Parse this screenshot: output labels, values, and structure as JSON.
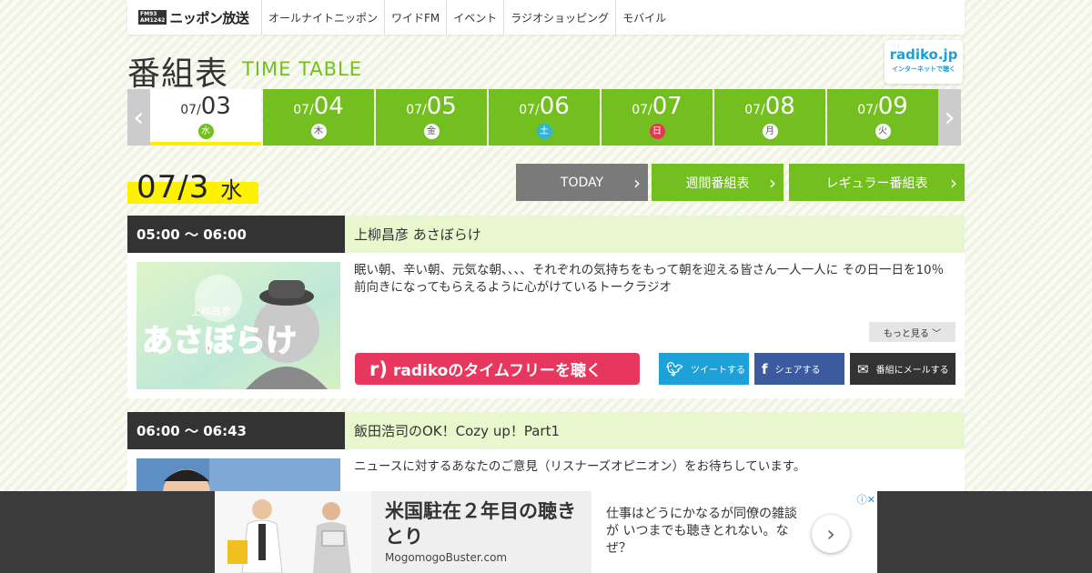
{
  "nav": {
    "logo_freq_top": "FM93",
    "logo_freq_bottom": "AM1242",
    "logo_name": "ニッポン放送",
    "items": [
      "オールナイトニッポン",
      "ワイドFM",
      "イベント",
      "ラジオショッピング",
      "モバイル"
    ]
  },
  "header": {
    "title_jp": "番組表",
    "title_en": "TIME TABLE",
    "radiko_logo": "radiko.jp",
    "radiko_sub": "インターネットで聴く"
  },
  "date_tabs": {
    "prev_icon": "chevron-left-icon",
    "next_icon": "chevron-right-icon",
    "items": [
      {
        "month": "07/",
        "day": "03",
        "weekday": "水"
      },
      {
        "month": "07/",
        "day": "04",
        "weekday": "木"
      },
      {
        "month": "07/",
        "day": "05",
        "weekday": "金"
      },
      {
        "month": "07/",
        "day": "06",
        "weekday": "土"
      },
      {
        "month": "07/",
        "day": "07",
        "weekday": "日"
      },
      {
        "month": "07/",
        "day": "08",
        "weekday": "月"
      },
      {
        "month": "07/",
        "day": "09",
        "weekday": "火"
      }
    ]
  },
  "current_day": {
    "date": "07/3",
    "weekday": "水"
  },
  "actions": {
    "today": "TODAY",
    "weekly": "週間番組表",
    "regular": "レギュラー番組表"
  },
  "programs": [
    {
      "time": "05:00 ～ 06:00",
      "title": "上柳昌彦 あさぼらけ",
      "image_text": "あさぼらけ",
      "image_small": "上柳昌彦",
      "description": "眠い朝、辛い朝、元気な朝、、、、それぞれの気持ちをもって朝を迎える皆さん一人一人に その日一日を10％前向きになってもらえるように心がけているトークラジオ",
      "more": "もっと見る",
      "radiko_button": "radikoのタイムフリーを聴く",
      "tweet": "ツイートする",
      "share": "シェアする",
      "mail": "番組にメールする"
    },
    {
      "time": "06:00 ～ 06:43",
      "title": "飯田浩司のOK！Cozy up！Part1",
      "description": "ニュースに対するあなたのご意見（リスナーズオピニオン）をお待ちしています。"
    }
  ],
  "ad": {
    "headline": "米国駐在２年目の聴きとり",
    "site": "MogomogoBuster.com",
    "text": "仕事はどうにかなるが同僚の雑談が いつまでも聴きとれない。なぜ？",
    "close_icons": "ⓘ✕"
  },
  "colors": {
    "brand_green": "#72bf1f",
    "light_green": "#e8f7cd",
    "highlight_yellow": "#fff200",
    "radiko_pink": "#e8375e",
    "twitter": "#1da1d8",
    "facebook": "#3b5b9e"
  }
}
